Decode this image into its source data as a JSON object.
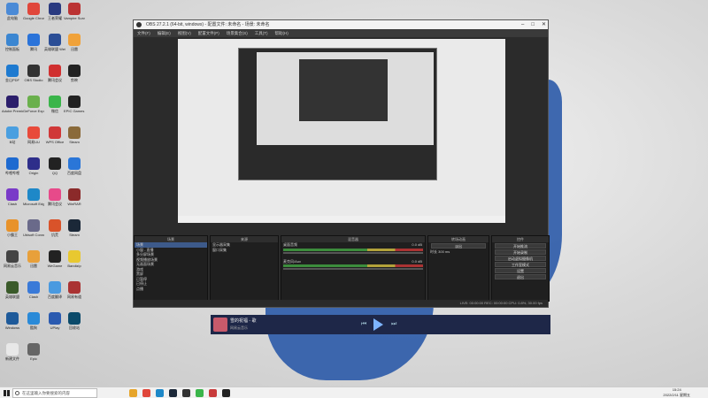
{
  "desktop_icons": [
    {
      "label": "此电脑",
      "color": "#4b8ad6"
    },
    {
      "label": "Google Chrome",
      "color": "#e0463a"
    },
    {
      "label": "王者荣耀",
      "color": "#2a3a80"
    },
    {
      "label": "Vampire Survivors",
      "color": "#b33"
    },
    {
      "label": "控制面板",
      "color": "#3b86d1"
    },
    {
      "label": "腾讯",
      "color": "#2a73d9"
    },
    {
      "label": "英雄联盟 WeGame版",
      "color": "#2b4e96"
    },
    {
      "label": "迅雷",
      "color": "#f0a23a"
    },
    {
      "label": "金山PDF",
      "color": "#1e7ad0"
    },
    {
      "label": "OBS Studio",
      "color": "#333"
    },
    {
      "label": "腾讯会议",
      "color": "#d03030"
    },
    {
      "label": "剪映",
      "color": "#222"
    },
    {
      "label": "Adobe Premiere",
      "color": "#2b1e6b"
    },
    {
      "label": "GeForce Experience",
      "color": "#6ab04c"
    },
    {
      "label": "微信",
      "color": "#3ab54a"
    },
    {
      "label": "EPIC Games Launcher",
      "color": "#222"
    },
    {
      "label": "B站",
      "color": "#4a9fe0"
    },
    {
      "label": "网易UU",
      "color": "#e84a3a"
    },
    {
      "label": "WPS Office",
      "color": "#d03838"
    },
    {
      "label": "Steam",
      "color": "#8a6a3a"
    },
    {
      "label": "哔哩哔哩",
      "color": "#1e6ad0"
    },
    {
      "label": "Origin",
      "color": "#2e2e8a"
    },
    {
      "label": "QQ",
      "color": "#222"
    },
    {
      "label": "百度网盘",
      "color": "#2a76d8"
    },
    {
      "label": "Clash",
      "color": "#7a3ac8"
    },
    {
      "label": "Microsoft Edge",
      "color": "#1e88c8"
    },
    {
      "label": "腾讯会议",
      "color": "#e74a8a"
    },
    {
      "label": "WinRAR",
      "color": "#8b2a2a"
    },
    {
      "label": "小霸王",
      "color": "#e8922a"
    },
    {
      "label": "Ubisoft Connect",
      "color": "#6a6a8a"
    },
    {
      "label": "饥荒",
      "color": "#d9532a"
    },
    {
      "label": "Steam",
      "color": "#1b2838"
    },
    {
      "label": "网易云音乐",
      "color": "#444"
    },
    {
      "label": "迅雷",
      "color": "#e8a03a"
    },
    {
      "label": "WeGame",
      "color": "#222"
    },
    {
      "label": "Bandizip",
      "color": "#e8c830"
    },
    {
      "label": "英雄联盟",
      "color": "#3a5a2a"
    },
    {
      "label": "Clash",
      "color": "#3a7ad8"
    },
    {
      "label": "百度翻译",
      "color": "#4a9ae0"
    },
    {
      "label": "网易有道",
      "color": "#a33"
    },
    {
      "label": "Windows",
      "color": "#1e5a9a"
    },
    {
      "label": "酷狗",
      "color": "#2a8ad8"
    },
    {
      "label": "UPlay",
      "color": "#2a5ab0"
    },
    {
      "label": "回收站",
      "color": "#0b4a6a"
    },
    {
      "label": "新建文件",
      "color": "#e8e8e8"
    },
    {
      "label": "Epic",
      "color": "#666"
    }
  ],
  "obs": {
    "title": "OBS 27.2.1 (64-bit, windows) - 配置文件: 未命名 - 场景: 未命名",
    "menu": [
      "文件(F)",
      "编辑(E)",
      "视图(V)",
      "配置文件(P)",
      "场景集合(S)",
      "工具(T)",
      "帮助(H)"
    ],
    "scenes_header": "场景",
    "scenes": [
      "场景",
      "小窗 - 直播",
      "多分屏场景",
      "视频播放场景",
      "无画面场景",
      "游戏",
      "黑屏",
      "已暂停",
      "已停止",
      "点播"
    ],
    "sources_header": "来源",
    "sources": [
      "显示器采集",
      "窗口采集"
    ],
    "mixer_header": "混音器",
    "mixer_tracks": [
      {
        "name": "桌面音频",
        "db": "0.0 dB"
      },
      {
        "name": "麦克风/Aux",
        "db": "0.0 dB"
      }
    ],
    "transition_header": "转场动画",
    "transition": {
      "label": "淡出",
      "duration_label": "时长",
      "duration": "300 ms"
    },
    "controls_header": "控件",
    "controls": [
      "开始推流",
      "开始录制",
      "启动虚拟摄像机",
      "工作室模式",
      "设置",
      "退出"
    ],
    "status": "LIVE: 00:00:00   REC: 00:00:00   CPU: 0.8%, 30.00 fps"
  },
  "player": {
    "song": "雪的祝福 - 歌",
    "artist": "网易云音乐"
  },
  "taskbar": {
    "search_placeholder": "在这里输入你要搜索的内容",
    "time": "15:24",
    "date": "2022/2/11 星期五",
    "apps": [
      "file-explorer",
      "chrome",
      "edge",
      "steam",
      "obs",
      "wechat",
      "music",
      "qq"
    ]
  },
  "colors": {
    "accent": "#3d5a8a",
    "wallpaper": "#d9d9d9",
    "obs_bg": "#2b2b2b"
  }
}
